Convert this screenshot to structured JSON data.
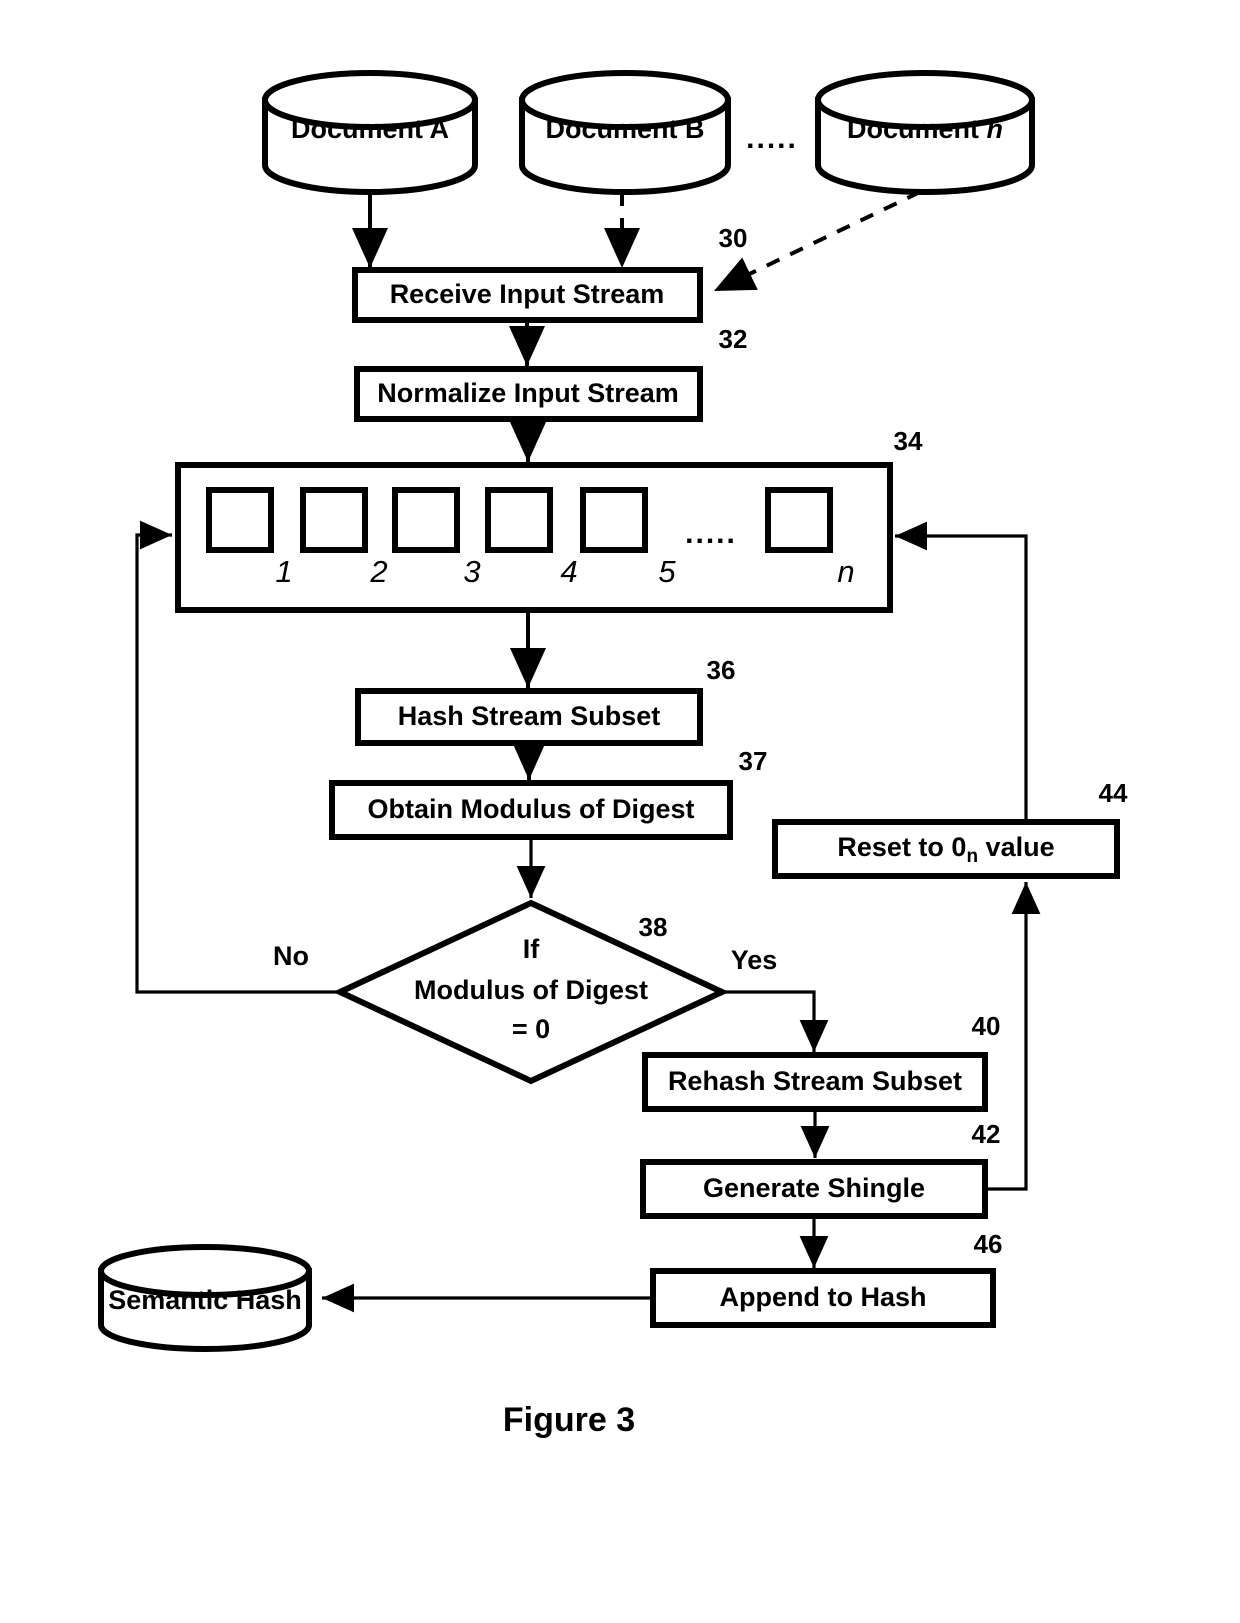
{
  "figure": {
    "caption": "Figure 3"
  },
  "sources": {
    "ellipsis": ".....",
    "cylinders": [
      {
        "id": "doc-a",
        "label_main": "Document",
        "label_suffix": "A"
      },
      {
        "id": "doc-b",
        "label_main": "Document",
        "label_suffix": "B"
      },
      {
        "id": "doc-n",
        "label_main": "Document",
        "label_suffix": "n"
      }
    ]
  },
  "process_boxes": [
    {
      "id": "receive-input-stream",
      "label": "Receive Input Stream",
      "ref": "30"
    },
    {
      "id": "normalize-input-stream",
      "label": "Normalize Input Stream",
      "ref": "32"
    },
    {
      "id": "hash-stream-subset",
      "label": "Hash Stream Subset",
      "ref": "36"
    },
    {
      "id": "obtain-modulus-of-digest",
      "label": "Obtain Modulus of Digest",
      "ref": "37"
    },
    {
      "id": "reset-to-0n-value",
      "label_before": "Reset to 0",
      "label_sub": "n",
      "label_after": " value",
      "ref": "44"
    },
    {
      "id": "rehash-stream-subset",
      "label": "Rehash Stream Subset",
      "ref": "40"
    },
    {
      "id": "generate-shingle",
      "label": "Generate Shingle",
      "ref": "42"
    },
    {
      "id": "append-to-hash",
      "label": "Append to Hash",
      "ref": "46"
    }
  ],
  "stream_array": {
    "ref": "34",
    "cell_labels": [
      "1",
      "2",
      "3",
      "4",
      "5",
      "n"
    ],
    "ellipsis": "....."
  },
  "decision": {
    "id": "modulus-decision",
    "ref": "38",
    "line1": "If",
    "line2": "Modulus of Digest",
    "line3": "= 0",
    "branch_no": "No",
    "branch_yes": "Yes"
  },
  "output": {
    "id": "semantic-hash",
    "label": "Semantic Hash"
  },
  "colors": {
    "stroke": "#000000",
    "fill": "#ffffff"
  }
}
